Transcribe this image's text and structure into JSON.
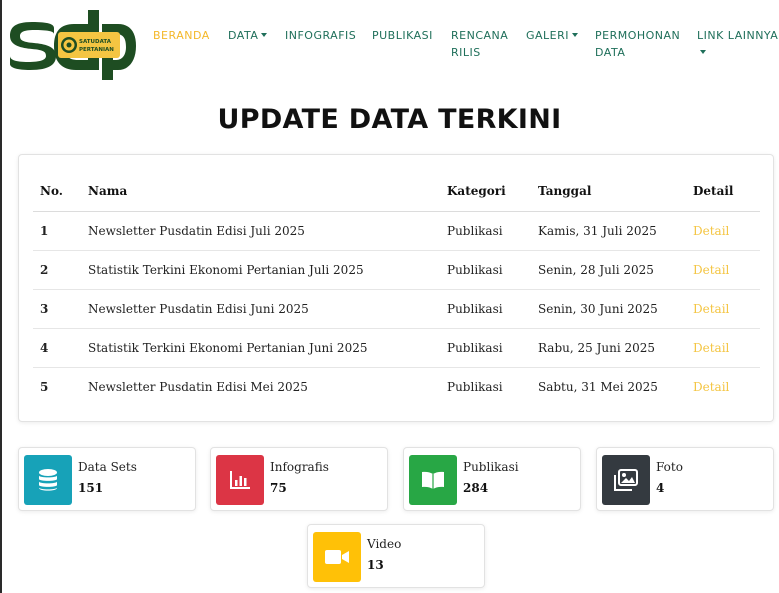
{
  "header": {
    "logo_letters": "sdp",
    "logo_subtitle_1": "SATUDATA",
    "logo_subtitle_2": "PERTANIAN",
    "nav": [
      {
        "label": "BERANDA",
        "active": true
      },
      {
        "label": "DATA",
        "dropdown": true
      },
      {
        "label": "INFOGRAFIS"
      },
      {
        "label": "PUBLIKASI"
      },
      {
        "label_line1": "RENCANA",
        "label_line2": "RILIS"
      },
      {
        "label": "GALERI",
        "dropdown": true
      },
      {
        "label_line1": "PERMOHONAN",
        "label_line2": "DATA"
      },
      {
        "label": "LINK LAINNYA",
        "dropdown": true
      }
    ]
  },
  "title": "UPDATE DATA TERKINI",
  "table": {
    "headers": [
      "No.",
      "Nama",
      "Kategori",
      "Tanggal",
      "Detail"
    ],
    "rows": [
      {
        "no": "1",
        "nama": "Newsletter Pusdatin Edisi Juli 2025",
        "kategori": "Publikasi",
        "tanggal": "Kamis, 31 Juli 2025",
        "detail": "Detail"
      },
      {
        "no": "2",
        "nama": "Statistik Terkini Ekonomi Pertanian Juli 2025",
        "kategori": "Publikasi",
        "tanggal": "Senin, 28 Juli 2025",
        "detail": "Detail"
      },
      {
        "no": "3",
        "nama": "Newsletter Pusdatin Edisi Juni 2025",
        "kategori": "Publikasi",
        "tanggal": "Senin, 30 Juni 2025",
        "detail": "Detail"
      },
      {
        "no": "4",
        "nama": "Statistik Terkini Ekonomi Pertanian Juni 2025",
        "kategori": "Publikasi",
        "tanggal": "Rabu, 25 Juni 2025",
        "detail": "Detail"
      },
      {
        "no": "5",
        "nama": "Newsletter Pusdatin Edisi Mei 2025",
        "kategori": "Publikasi",
        "tanggal": "Sabtu, 31 Mei 2025",
        "detail": "Detail"
      }
    ]
  },
  "stats": [
    {
      "label": "Data Sets",
      "value": "151",
      "icon": "database-icon",
      "color": "#17a2b8"
    },
    {
      "label": "Infografis",
      "value": "75",
      "icon": "bar-chart-icon",
      "color": "#dc3545"
    },
    {
      "label": "Publikasi",
      "value": "284",
      "icon": "open-book-icon",
      "color": "#28a745"
    },
    {
      "label": "Foto",
      "value": "4",
      "icon": "photo-icon",
      "color": "#343a40"
    },
    {
      "label": "Video",
      "value": "13",
      "icon": "video-camera-icon",
      "color": "#ffc107"
    }
  ],
  "colors": {
    "nav_text": "#1f6f5a",
    "nav_active": "#f4b82a",
    "logo_green": "#1e4d22",
    "detail_link": "#f4c542"
  }
}
